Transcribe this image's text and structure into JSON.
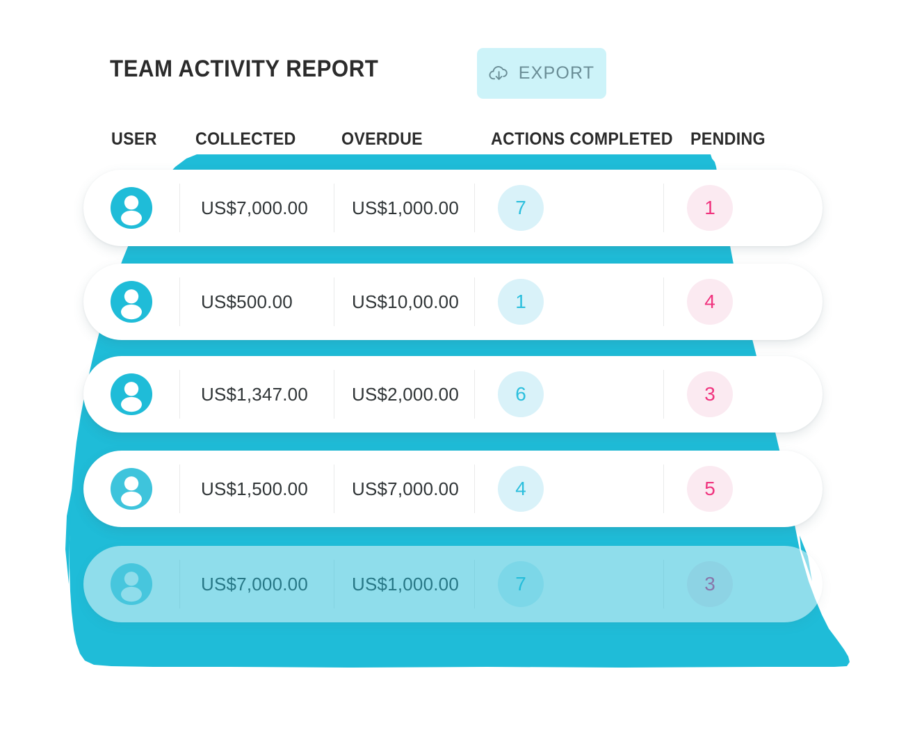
{
  "page": {
    "title": "TEAM ACTIVITY REPORT",
    "background": "#ffffff"
  },
  "toolbar": {
    "export_label": "EXPORT",
    "export_icon": "cloud-download-icon",
    "export_bg": "#cdf3f9",
    "export_text_color": "#6a8d96"
  },
  "colors": {
    "accent_cyan": "#1fbcd8",
    "badge_actions_bg": "#d9f2f9",
    "badge_actions_text": "#2cbfdd",
    "badge_pending_bg": "#fbeaf1",
    "badge_pending_text": "#f0337e",
    "title_text": "#2b2b2b",
    "value_text": "#2f3436",
    "divider": "#e9eaea"
  },
  "table": {
    "columns": [
      {
        "key": "user",
        "label": "USER"
      },
      {
        "key": "collected",
        "label": "COLLECTED"
      },
      {
        "key": "overdue",
        "label": "OVERDUE"
      },
      {
        "key": "actions",
        "label": "ACTIONS COMPLETED"
      },
      {
        "key": "pending",
        "label": "PENDING"
      }
    ],
    "rows": [
      {
        "avatar_icon": "user-avatar-icon",
        "collected": "US$7,000.00",
        "overdue": "US$1,000.00",
        "actions": "7",
        "pending": "1",
        "faded": false
      },
      {
        "avatar_icon": "user-avatar-icon",
        "collected": "US$500.00",
        "overdue": "US$10,00.00",
        "actions": "1",
        "pending": "4",
        "faded": false
      },
      {
        "avatar_icon": "user-avatar-icon",
        "collected": "US$1,347.00",
        "overdue": "US$2,000.00",
        "actions": "6",
        "pending": "3",
        "faded": false
      },
      {
        "avatar_icon": "user-avatar-icon",
        "collected": "US$1,500.00",
        "overdue": "US$7,000.00",
        "actions": "4",
        "pending": "5",
        "faded": false
      },
      {
        "avatar_icon": "user-avatar-icon",
        "collected": "US$7,000.00",
        "overdue": "US$1,000.00",
        "actions": "7",
        "pending": "3",
        "faded": true
      }
    ]
  }
}
